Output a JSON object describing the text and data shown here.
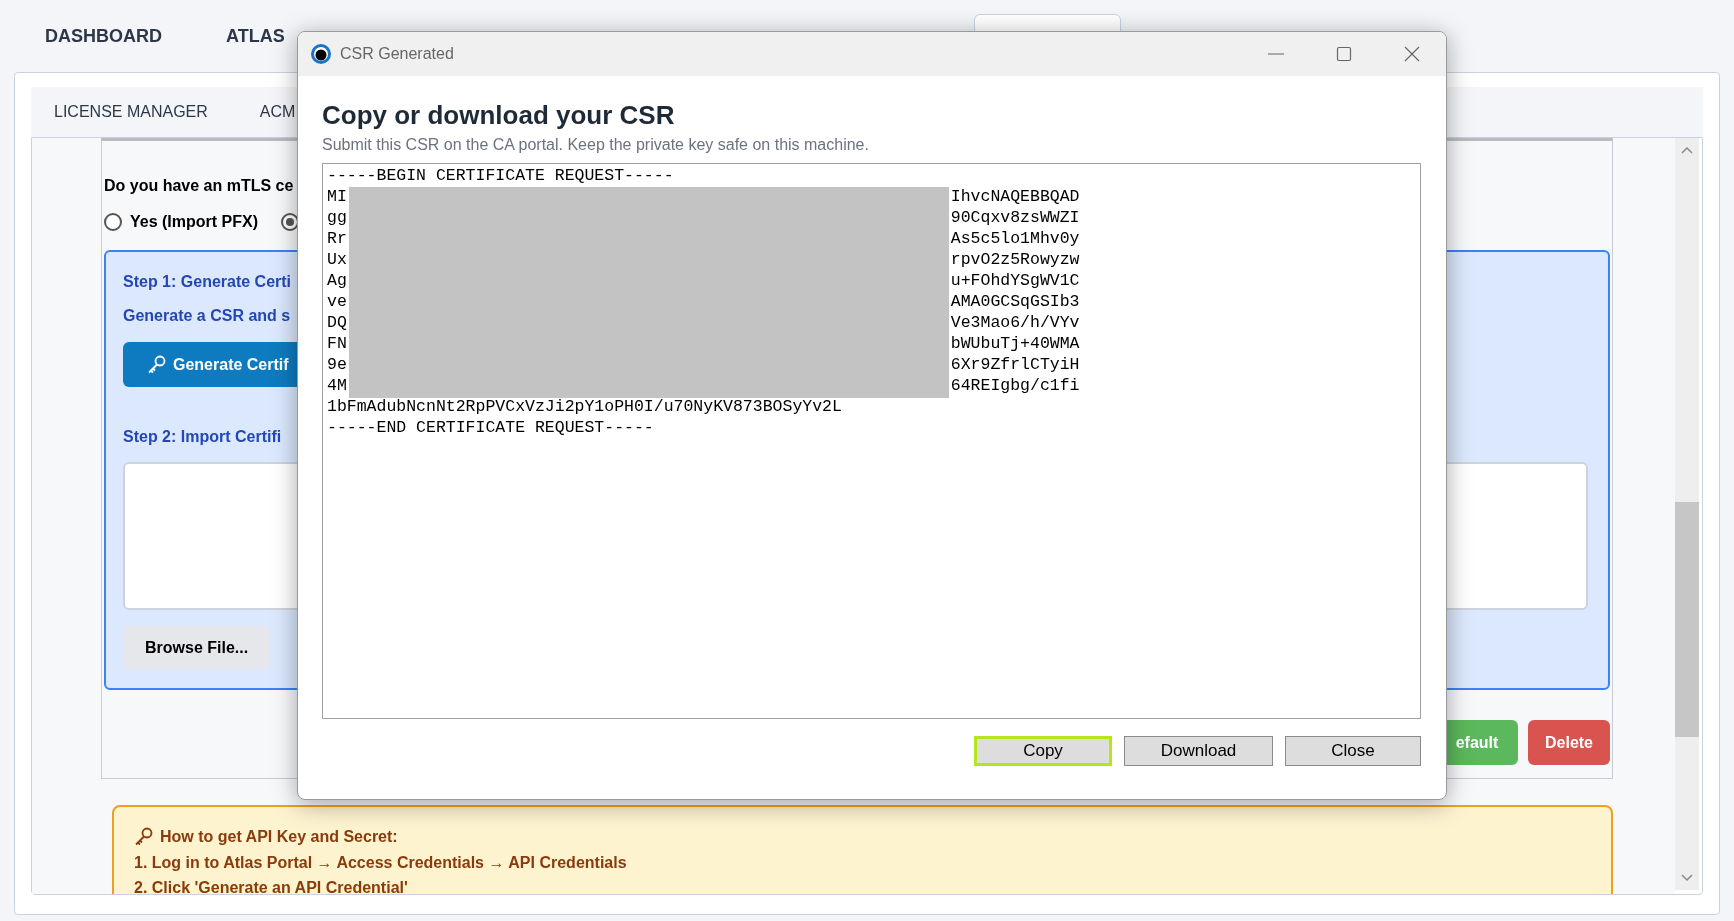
{
  "top_nav": [
    {
      "label": "DASHBOARD"
    },
    {
      "label": "ATLAS"
    }
  ],
  "sub_tabs": [
    {
      "label": "LICENSE MANAGER"
    },
    {
      "label": "ACM"
    }
  ],
  "mtls": {
    "question": "Do you have an mTLS ce",
    "options": [
      {
        "label": "Yes (Import PFX)",
        "selected": false
      },
      {
        "selected": true
      }
    ]
  },
  "step1": {
    "title": "Step 1: Generate Certi",
    "text": "Generate a CSR and s",
    "button": "Generate Certif"
  },
  "step2": {
    "title": "Step 2: Import Certifi",
    "browse_button": "Browse File..."
  },
  "actions": [
    {
      "label": "efault",
      "kind": "success"
    },
    {
      "label": "Delete",
      "kind": "danger"
    }
  ],
  "help": {
    "title": "How to get API Key and Secret:",
    "steps": [
      "1. Log in to Atlas Portal → Access Credentials → API Credentials",
      "2. Click 'Generate an API Credential'"
    ]
  },
  "dialog": {
    "title": "CSR Generated",
    "heading": "Copy or download your CSR",
    "subtitle": "Submit this CSR on the CA portal. Keep the private key safe on this machine.",
    "csr_lines": [
      {
        "text": "-----BEGIN CERTIFICATE REQUEST-----"
      },
      {
        "start": "MI",
        "end": "IhvcNAQEBBQAD"
      },
      {
        "start": "gg",
        "end": "90Cqxv8zsWWZI"
      },
      {
        "start": "Rr",
        "end": "As5c5lo1Mhv0y"
      },
      {
        "start": "Ux",
        "end": "rpvO2z5Rowyzw"
      },
      {
        "start": "Ag",
        "end": "u+FOhdYSgWV1C"
      },
      {
        "start": "ve",
        "end": "AMA0GCSqGSIb3"
      },
      {
        "start": "DQ",
        "end": "Ve3Mao6/h/VYv"
      },
      {
        "start": "FN",
        "end": "bWUbuTj+40WMA"
      },
      {
        "start": "9e",
        "end": "6Xr9ZfrlCTyiH"
      },
      {
        "start": "4M",
        "end": "64REIgbg/c1fi"
      },
      {
        "text": "1bFmAdubNcnNt2RpPVCxVzJi2pY1oPH0I/u70NyKV873BOSyYv2L"
      },
      {
        "text": "-----END CERTIFICATE REQUEST-----"
      }
    ],
    "buttons": [
      {
        "label": "Copy",
        "focused": true
      },
      {
        "label": "Download",
        "focused": false
      },
      {
        "label": "Close",
        "focused": false
      }
    ]
  }
}
